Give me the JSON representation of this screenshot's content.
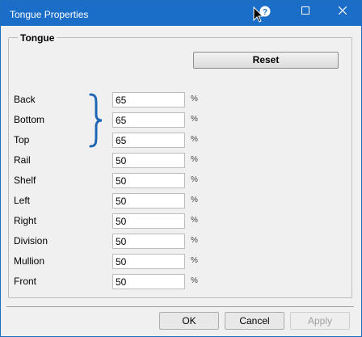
{
  "window": {
    "title": "Tongue Properties"
  },
  "group": {
    "title": "Tongue"
  },
  "reset_label": "Reset",
  "rows": [
    {
      "label": "Back",
      "value": "65",
      "unit": "%"
    },
    {
      "label": "Bottom",
      "value": "65",
      "unit": "%"
    },
    {
      "label": "Top",
      "value": "65",
      "unit": "%"
    },
    {
      "label": "Rail",
      "value": "50",
      "unit": "%"
    },
    {
      "label": "Shelf",
      "value": "50",
      "unit": "%"
    },
    {
      "label": "Left",
      "value": "50",
      "unit": "%"
    },
    {
      "label": "Right",
      "value": "50",
      "unit": "%"
    },
    {
      "label": "Division",
      "value": "50",
      "unit": "%"
    },
    {
      "label": "Mullion",
      "value": "50",
      "unit": "%"
    },
    {
      "label": "Front",
      "value": "50",
      "unit": "%"
    }
  ],
  "buttons": {
    "ok": "OK",
    "cancel": "Cancel",
    "apply": "Apply"
  },
  "colors": {
    "titlebar": "#1a6ec8",
    "brace": "#1f66b5"
  }
}
